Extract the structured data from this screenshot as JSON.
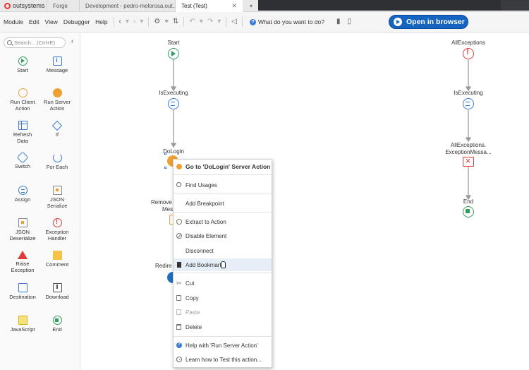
{
  "titlebar": {
    "brand": "outsystems",
    "tabs": [
      {
        "label": "Forge"
      },
      {
        "label": "Development - pedro-melorosa.out..."
      },
      {
        "label": "Test (Test)",
        "close": "✕"
      }
    ],
    "more": "▾"
  },
  "menubar": {
    "items": [
      "Module",
      "Edit",
      "View",
      "Debugger",
      "Help"
    ],
    "what_label": "What do you want to do?",
    "open_browser": "Open in browser"
  },
  "toolbox": {
    "search_placeholder": "Search... (Ctrl+E)",
    "collapse": "‹",
    "tools": [
      {
        "label": "Start",
        "icon": "start-icon"
      },
      {
        "label": "Message",
        "icon": "message-icon"
      },
      {
        "label": "Run Client\nAction",
        "icon": "client-action-icon"
      },
      {
        "label": "Run Server\nAction",
        "icon": "server-action-icon"
      },
      {
        "label": "Refresh\nData",
        "icon": "refresh-data-icon"
      },
      {
        "label": "If",
        "icon": "if-icon"
      },
      {
        "label": "Switch",
        "icon": "switch-icon"
      },
      {
        "label": "For Each",
        "icon": "for-each-icon"
      },
      {
        "label": "Assign",
        "icon": "assign-icon"
      },
      {
        "label": "JSON\nSerialize",
        "icon": "json-serialize-icon"
      },
      {
        "label": "JSON\nDeserialize",
        "icon": "json-deserialize-icon"
      },
      {
        "label": "Exception\nHandler",
        "icon": "exception-handler-icon"
      },
      {
        "label": "Raise\nException",
        "icon": "raise-exception-icon"
      },
      {
        "label": "Comment",
        "icon": "comment-icon"
      },
      {
        "label": "Destination",
        "icon": "destination-icon"
      },
      {
        "label": "Download",
        "icon": "download-icon"
      },
      {
        "label": "JavaScript",
        "icon": "javascript-icon"
      },
      {
        "label": "End",
        "icon": "end-icon"
      }
    ]
  },
  "canvas": {
    "left_flow": {
      "start": "Start",
      "is_executing": "IsExecuting",
      "do_login": "DoLogin",
      "remove_line1": "Remove",
      "remove_line2": "Mess",
      "redirect": "Redire"
    },
    "right_flow": {
      "all_exceptions": "AllExceptions",
      "is_executing": "IsExecuting",
      "exc_msg_line1": "AllExceptions.",
      "exc_msg_line2": "ExceptionMessa...",
      "end": "End"
    }
  },
  "context_menu": {
    "header": "Go to 'DoLogin' Server Action",
    "find_usages": "Find Usages",
    "add_breakpoint": "Add Breakpoint",
    "extract": "Extract to Action",
    "disable": "Disable Element",
    "disconnect": "Disconnect",
    "add_bookmark": "Add Bookmark",
    "cut": "Cut",
    "copy": "Copy",
    "paste": "Paste",
    "delete": "Delete",
    "help": "Help with 'Run Server Action'",
    "learn": "Learn how to Test this action..."
  },
  "colors": {
    "accent_blue": "#1565c0",
    "server_orange": "#f0a030",
    "start_green": "#2e9e5b",
    "error_red": "#e53935"
  }
}
